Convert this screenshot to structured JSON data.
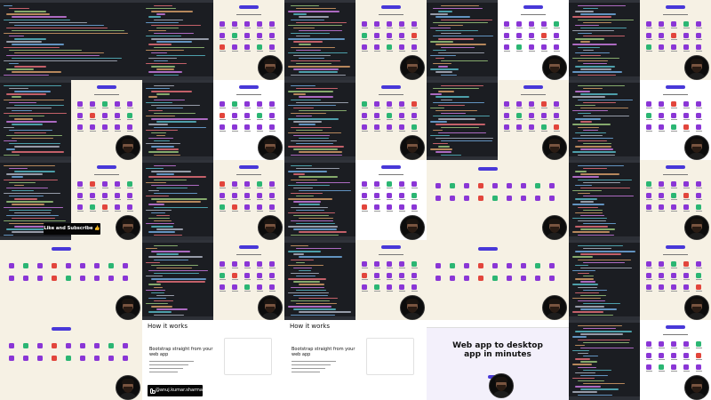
{
  "overlays": {
    "like_subscribe": "Like and Subscribe 👍",
    "instagram": "@anuj.kumar.sharma"
  },
  "texts": {
    "how_it_works": "How it works",
    "bootstrap_line1": "Bootstrap straight from your",
    "bootstrap_line2": "web app",
    "hero_line1": "Web app to desktop",
    "hero_line2": "app in minutes"
  },
  "colors": {
    "editor_bg": "#1b1d22",
    "preview_bg": "#f6f1e4",
    "accent": "#4838d8",
    "icon": "#8a36d6"
  },
  "tiles": [
    {
      "id": "r0c0",
      "kind": "code"
    },
    {
      "id": "r0c1",
      "kind": "split",
      "right": "icons-with-avatar"
    },
    {
      "id": "r0c2",
      "kind": "split",
      "right": "icons-with-avatar"
    },
    {
      "id": "r0c3",
      "kind": "split",
      "right": "icons-with-avatar"
    },
    {
      "id": "r0c4",
      "kind": "split",
      "right": "icons-with-avatar"
    },
    {
      "id": "r1c0",
      "kind": "split",
      "right": "icons-with-avatar"
    },
    {
      "id": "r1c1",
      "kind": "split",
      "right": "icons-with-avatar"
    },
    {
      "id": "r1c2",
      "kind": "split",
      "right": "icons-with-avatar"
    },
    {
      "id": "r1c3",
      "kind": "split",
      "right": "icons-with-avatar"
    },
    {
      "id": "r1c4",
      "kind": "split",
      "right": "icons-with-avatar"
    },
    {
      "id": "r2c0",
      "kind": "split",
      "right": "icons-with-avatar"
    },
    {
      "id": "r2c1",
      "kind": "split",
      "right": "icons-with-avatar"
    },
    {
      "id": "r2c2",
      "kind": "split",
      "right": "icons-with-avatar"
    },
    {
      "id": "r2c3",
      "kind": "preview",
      "right": "icons-with-avatar"
    },
    {
      "id": "r2c4",
      "kind": "split",
      "right": "icons-with-avatar"
    },
    {
      "id": "r3c0",
      "kind": "preview",
      "right": "icons-with-avatar"
    },
    {
      "id": "r3c1",
      "kind": "split",
      "right": "icons-with-avatar"
    },
    {
      "id": "r3c2",
      "kind": "split",
      "right": "icons-with-avatar"
    },
    {
      "id": "r3c3",
      "kind": "preview",
      "right": "icons-with-avatar"
    },
    {
      "id": "r3c4",
      "kind": "split",
      "right": "icons-with-avatar"
    },
    {
      "id": "r4c0",
      "kind": "preview",
      "right": "icons-with-avatar"
    },
    {
      "id": "r4c1",
      "kind": "how-it-works"
    },
    {
      "id": "r4c2",
      "kind": "how-it-works"
    },
    {
      "id": "r4c3",
      "kind": "hero"
    },
    {
      "id": "r4c4",
      "kind": "split",
      "right": "icons-with-avatar"
    }
  ]
}
